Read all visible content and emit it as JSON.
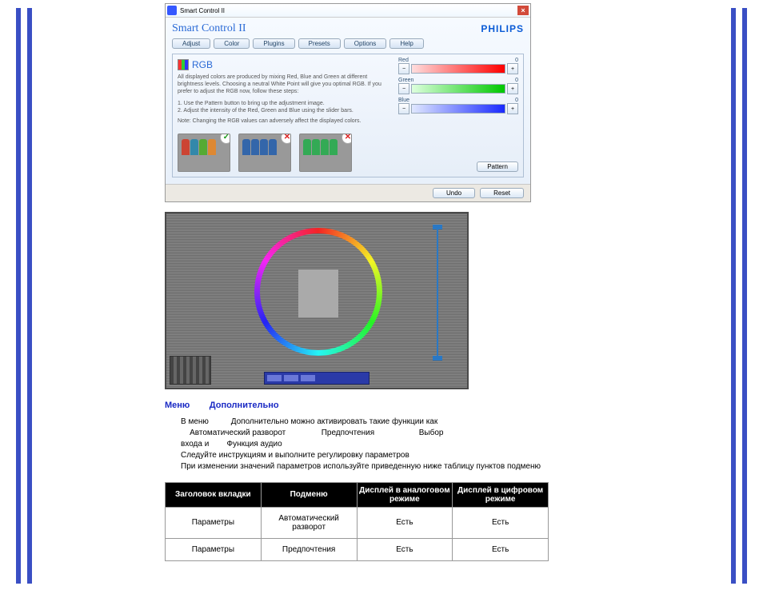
{
  "menu": {
    "label": "Меню",
    "sub": "Дополнительно"
  },
  "body_text": {
    "l1a": "В меню",
    "l1b": "Дополнительно  можно активировать такие функции  как",
    "l2a": "Автоматический разворот",
    "l2b": "Предпочтения",
    "l2c": "Выбор",
    "l3a": "входа  и",
    "l3b": "Функция аудио",
    "l4": "Следуйте инструкциям и выполните регулировку параметров",
    "l5": "При изменении значений параметров используйте приведенную ниже таблицу пунктов подменю"
  },
  "table": {
    "headers": [
      "Заголовок вкладки",
      "Подменю",
      "Дисплей в аналоговом режиме",
      "Дисплей в цифровом режиме"
    ],
    "rows": [
      [
        "Параметры",
        "Автоматический разворот",
        "Есть",
        "Есть"
      ],
      [
        "Параметры",
        "Предпочтения",
        "Есть",
        "Есть"
      ]
    ]
  },
  "dialog": {
    "window_title": "Smart Control II",
    "app_title": "Smart Control II",
    "brand": "PHILIPS",
    "tabs": [
      "Adjust",
      "Color",
      "Plugins",
      "Presets",
      "Options",
      "Help"
    ],
    "rgb": {
      "title": "RGB",
      "desc": "All displayed colors are produced by mixing Red, Blue and Green at different brightness levels. Choosing a neutral White Point will give you optimal RGB. If you prefer to adjust the RGB now, follow these steps:",
      "step1": "1. Use the Pattern button to bring up the adjustment image.",
      "step2": "2. Adjust the intensity of the Red, Green and Blue using the slider bars.",
      "note": "Note: Changing the RGB values can adversely affect the displayed colors."
    },
    "sliders": [
      {
        "name": "Red",
        "value": 0
      },
      {
        "name": "Green",
        "value": 0
      },
      {
        "name": "Blue",
        "value": 0
      }
    ],
    "pattern_btn": "Pattern",
    "undo": "Undo",
    "reset": "Reset"
  }
}
